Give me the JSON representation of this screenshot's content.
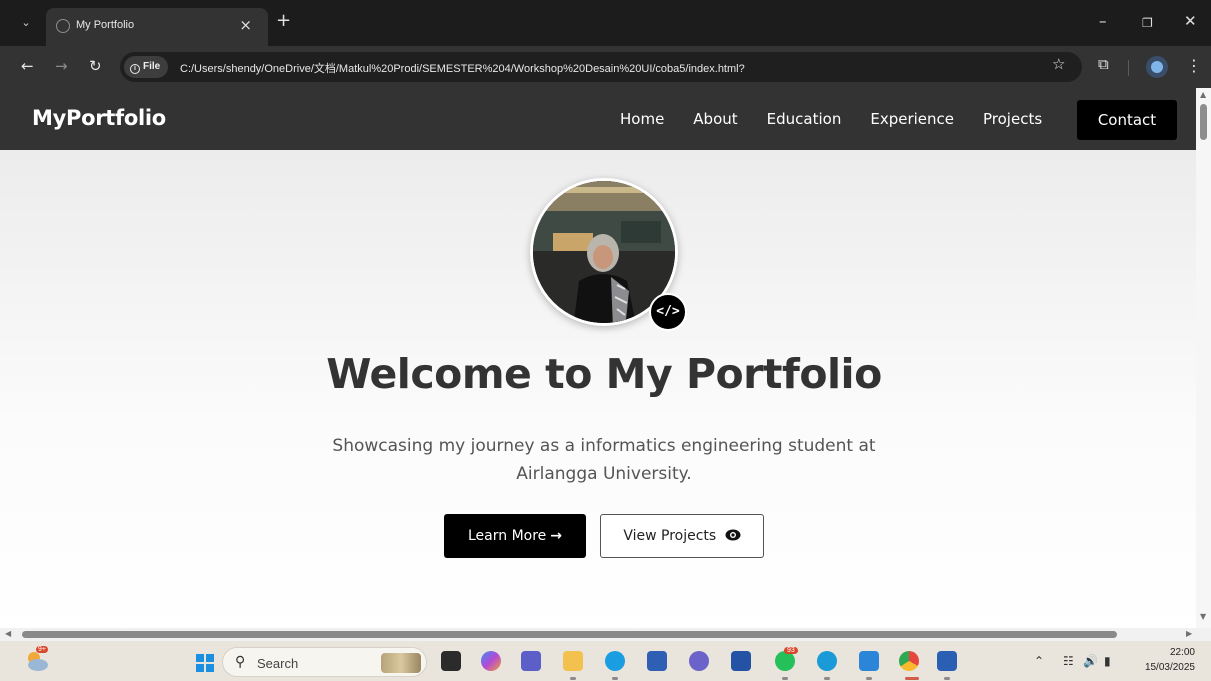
{
  "browser": {
    "tab_title": "My Portfolio",
    "url_prefix": "File",
    "url": "C:/Users/shendy/OneDrive/文档/Matkul%20Prodi/SEMESTER%204/Workshop%20Desain%20UI/coba5/index.html?",
    "icons": [
      "tab-list-icon",
      "globe-icon",
      "close-icon",
      "plus-icon",
      "minimize-icon",
      "restore-icon",
      "back-icon",
      "forward-icon",
      "reload-icon",
      "info-icon",
      "star-icon",
      "extensions-icon",
      "profile-icon",
      "kebab-menu-icon"
    ]
  },
  "site": {
    "brand": "MyPortfolio",
    "nav": [
      "Home",
      "About",
      "Education",
      "Experience",
      "Projects"
    ],
    "contact_label": "Contact"
  },
  "hero": {
    "badge_glyph": "</>",
    "title": "Welcome to My Portfolio",
    "subtitle": "Showcasing my journey as a informatics engineering student at Airlangga University.",
    "primary_label": "Learn More",
    "primary_icon": "→",
    "secondary_label": "View Projects",
    "secondary_icon": "eye-icon"
  },
  "taskbar": {
    "search_label": "Search",
    "weather_badge": "9+",
    "whatsapp_badge": "93",
    "time": "22:00",
    "date": "15/03/2025",
    "apps": [
      "file-explorer",
      "copilot",
      "teams",
      "folder",
      "edge",
      "store",
      "arc",
      "lexicon",
      "whatsapp",
      "azure-data",
      "vscode",
      "chrome",
      "word"
    ]
  },
  "colors": {
    "nav_bg": "#333333",
    "accent": "#000000",
    "title": "#333333",
    "taskbar_bg": "#e9e5dc"
  }
}
